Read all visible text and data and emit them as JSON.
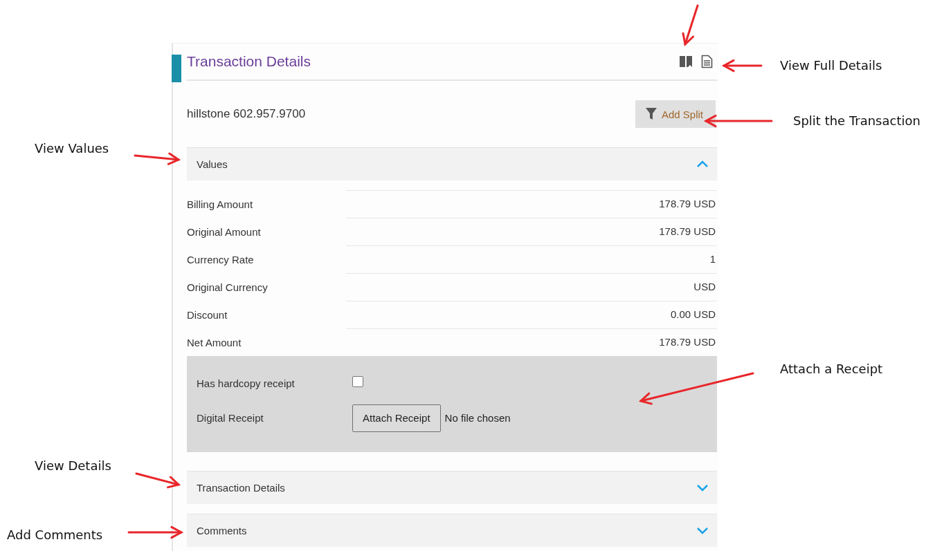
{
  "panel": {
    "title": "Transaction Details",
    "merchant": "hillstone 602.957.9700",
    "add_split": "Add Split",
    "sections": [
      {
        "title": "Values",
        "expanded": true,
        "rows": [
          {
            "label": "Billing Amount",
            "value": "178.79 USD"
          },
          {
            "label": "Original Amount",
            "value": "178.79 USD"
          },
          {
            "label": "Currency Rate",
            "value": "1"
          },
          {
            "label": "Original Currency",
            "value": "USD"
          },
          {
            "label": "Discount",
            "value": "0.00 USD"
          },
          {
            "label": "Net Amount",
            "value": "178.79 USD"
          }
        ],
        "receipt": {
          "hardcopy_label": "Has hardcopy receipt",
          "hardcopy_checked": false,
          "digital_label": "Digital Receipt",
          "attach_button": "Attach Receipt",
          "file_status": "No file chosen"
        }
      },
      {
        "title": "Transaction Details",
        "expanded": false
      },
      {
        "title": "Comments",
        "expanded": false
      }
    ]
  },
  "annotations": [
    {
      "text": "View Full Details"
    },
    {
      "text": "Split the Transaction"
    },
    {
      "text": "View Values"
    },
    {
      "text": "Attach a Receipt"
    },
    {
      "text": "View Details"
    },
    {
      "text": "Add Comments"
    }
  ]
}
